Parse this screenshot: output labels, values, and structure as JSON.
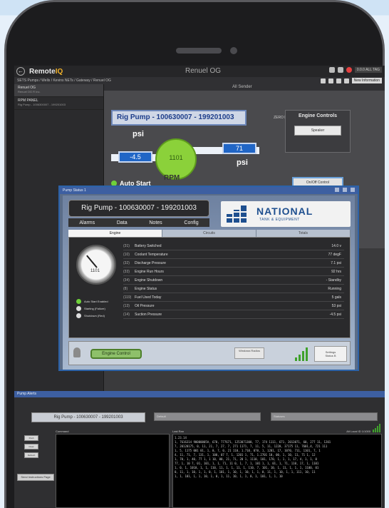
{
  "app": {
    "brand_a": "Remote",
    "brand_b": "IQ",
    "window_title": "Renuel OG",
    "top_user": "0.0.0 ALL TAG",
    "breadcrumb": "SETS Pumps / Wells / Kevins NETs / Gateway / Renuel OG",
    "crumb_button": "New Information"
  },
  "sidebar": {
    "items": [
      {
        "name": "Renuel OG",
        "sub": "Renuel OG R Inc."
      },
      {
        "name": "RPM PANEL",
        "sub": "Rig Pump - 1006300007 - 199201003"
      }
    ]
  },
  "dashboard": {
    "header": "All Sender",
    "pump_title": "Rig Pump - 100630007 - 199201003",
    "pump_mini": "ZERO L",
    "psi_left_label": "psi",
    "psi_left_value": "-4.5",
    "center_value": "1101",
    "psi_right_value": "71",
    "psi_right_label": "psi",
    "rpm_label": "RPM",
    "auto_start": "Auto Start",
    "engine_controls_title": "Engine Controls",
    "engine_controls_button": "Speaker",
    "on_off_button": "On/Off Control"
  },
  "dialog": {
    "title": "Pump Status 1",
    "pump_name": "Rig Pump - 100630007 - 199201003",
    "menu": [
      "Alarms",
      "Data",
      "Notes",
      "Config"
    ],
    "logo_main": "NATIONAL",
    "logo_sub": "TANK & EQUIPMENT",
    "tabs": [
      "Engine",
      "Circuits",
      "Totals"
    ],
    "gauge_text": "1101",
    "legend": [
      {
        "label": "Auto Start Enabled",
        "color": "#6fd13a"
      },
      {
        "label": "Starting (Failure)",
        "color": "#dddddd"
      },
      {
        "label": "Shutdown (Red)",
        "color": "#dddddd"
      }
    ],
    "rows": [
      {
        "code": "(31)",
        "label": "Battery Switched",
        "value": "14.0 v"
      },
      {
        "code": "(10)",
        "label": "Coolant Temperature",
        "value": "77 degF"
      },
      {
        "code": "(32)",
        "label": "Discharge Pressure",
        "value": "7.1 psi"
      },
      {
        "code": "(33)",
        "label": "Engine Run Hours",
        "value": "92 hrs"
      },
      {
        "code": "(34)",
        "label": "Engine Shutdown",
        "value": "- Standby"
      },
      {
        "code": "(8)",
        "label": "Engine Status",
        "value": "Running"
      },
      {
        "code": "(119)",
        "label": "Fuel Used Today",
        "value": "5 gals"
      },
      {
        "code": "(13)",
        "label": "Oil Pressure",
        "value": "53 psi"
      },
      {
        "code": "(14)",
        "label": "Suction Pressure",
        "value": "-4.5 psi"
      }
    ],
    "engine_control_button": "Engine Control",
    "bottom_small": "Windows Radios",
    "settings_button": "Settings",
    "settings_sub": "Status B"
  },
  "lower": {
    "title": "Pump Alerts",
    "pump_name": "Rig Pump - 100630007 - 199201003",
    "field_a": "Default",
    "field_b": "Statuses",
    "buttons": [
      "Push",
      "Clear",
      "Refresh"
    ],
    "send_button": "Send Instructions Page",
    "command_header": "Command",
    "log_header_left": "Last Ran",
    "log_header_right": "Alt   Local   ID 1/1000",
    "log_lines": [
      "1.23.14",
      "1, 7616314 90000005A, 670, 777671, 1253071300, 77, 174 1111, 671, 2013071, 60, 277 11, 1201",
      "7, 20120175, 0, 11, 21, 7, 27, 7, 271 1171, 7, 11, 5, 11, 1220, 37175 11, 7601,4, 721 111",
      "1, 5, 1175 001 01, 1, 0, 7, 0, 21 110, 1.710, 070, 1, 1201, 17, 1070, 711, 1101, 7, 1",
      "4, 11, 71, 7, 131, 1, 100, 07 7, 1, 1201 1, 71, 1.2701 10, 00, 1, 10, 11, 71 1, 12",
      "1, 70, 1, 40, 77 1, 1 10, 00, 21, 71, 20 1, 1110, 101, 170, 1, 1, 1, 17, 4, 1, 1, 0",
      "77, 1, 10 7, 01, 101, 1, 1, 71, 11 0, 1, 7, 1, 101 1, 1, 01, 1, 71, 110, 17, 1, 1101",
      "1, 0, 1, 1010, 1, 1, 110, 11, 1, 1, 11, 1, 110, 7, 101, 10, 1, 11, 1, 1, 1, 1100, 01",
      "0, 11, 1, 10, 1, 1, 0, 1, 101, 1, 10, 1, 10, 1, 1, 0, 11, 1, 10, 1, 1, 111, 10, 11",
      "1, 1, 101, 1, 1, 10, 1, 0, 1, 11, 10, 1, 1, 0, 1, 101, 1, 1, 10"
    ]
  }
}
